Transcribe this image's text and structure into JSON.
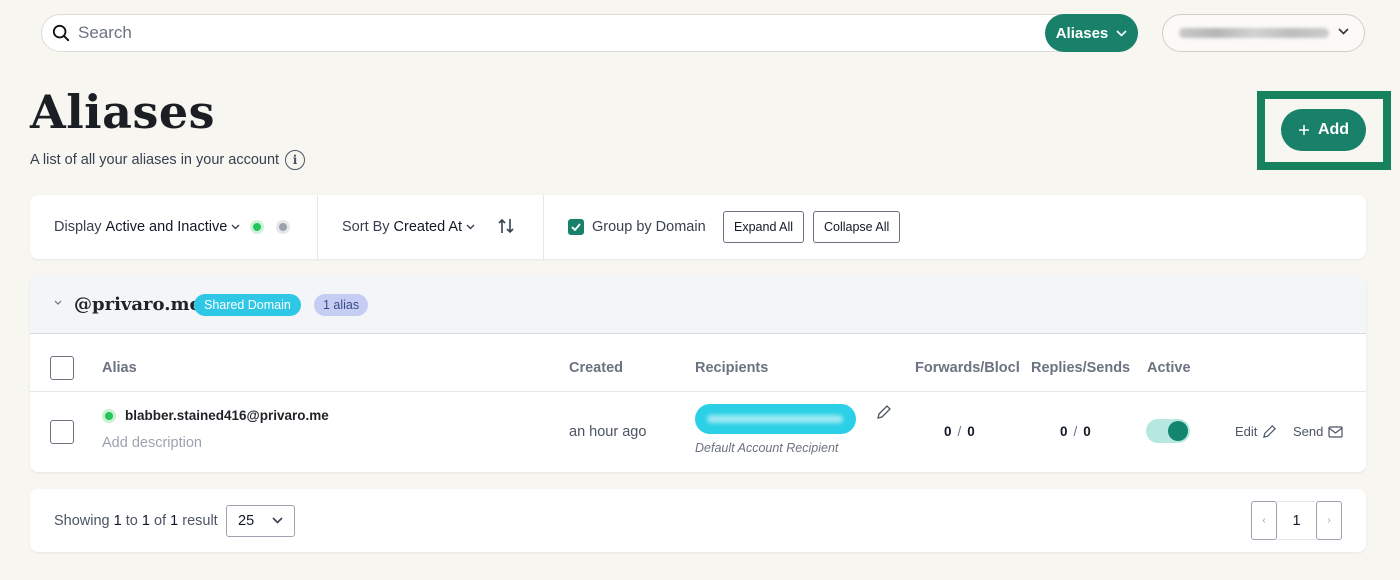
{
  "search": {
    "placeholder": "Search",
    "scope_label": "Aliases"
  },
  "page": {
    "title": "Aliases",
    "subtitle": "A list of all your aliases in your account",
    "add_label": "Add"
  },
  "filters": {
    "display_prefix": "Display",
    "display_value": "Active and Inactive",
    "sort_prefix": "Sort By",
    "sort_value": "Created At",
    "group_by_label": "Group by Domain",
    "group_by_checked": true,
    "expand_all": "Expand All",
    "collapse_all": "Collapse All"
  },
  "domain_group": {
    "name": "@privaro.me",
    "badge": "Shared Domain",
    "count_badge": "1 alias"
  },
  "table": {
    "columns": [
      "Alias",
      "Created",
      "Recipients",
      "Forwards/Blocks",
      "Replies/Sends",
      "Active"
    ],
    "rows": [
      {
        "email": "blabber.stained416@privaro.me",
        "description_placeholder": "Add description",
        "created": "an hour ago",
        "recipient_note": "Default Account Recipient",
        "forwards": "0",
        "blocks": "0",
        "replies": "0",
        "sends": "0",
        "active": true,
        "edit_label": "Edit",
        "send_label": "Send"
      }
    ]
  },
  "footer": {
    "showing_prefix": "Showing",
    "from": "1",
    "to_word": "to",
    "to": "1",
    "of_word": "of",
    "total": "1",
    "result_word": "result",
    "per_page": "25",
    "current_page": "1",
    "prev_glyph": "‹",
    "next_glyph": "›"
  },
  "colors": {
    "brand": "#19806a",
    "shared_badge": "#2fc7e6",
    "count_badge": "#c5cdf2",
    "highlight": "#16835e"
  }
}
